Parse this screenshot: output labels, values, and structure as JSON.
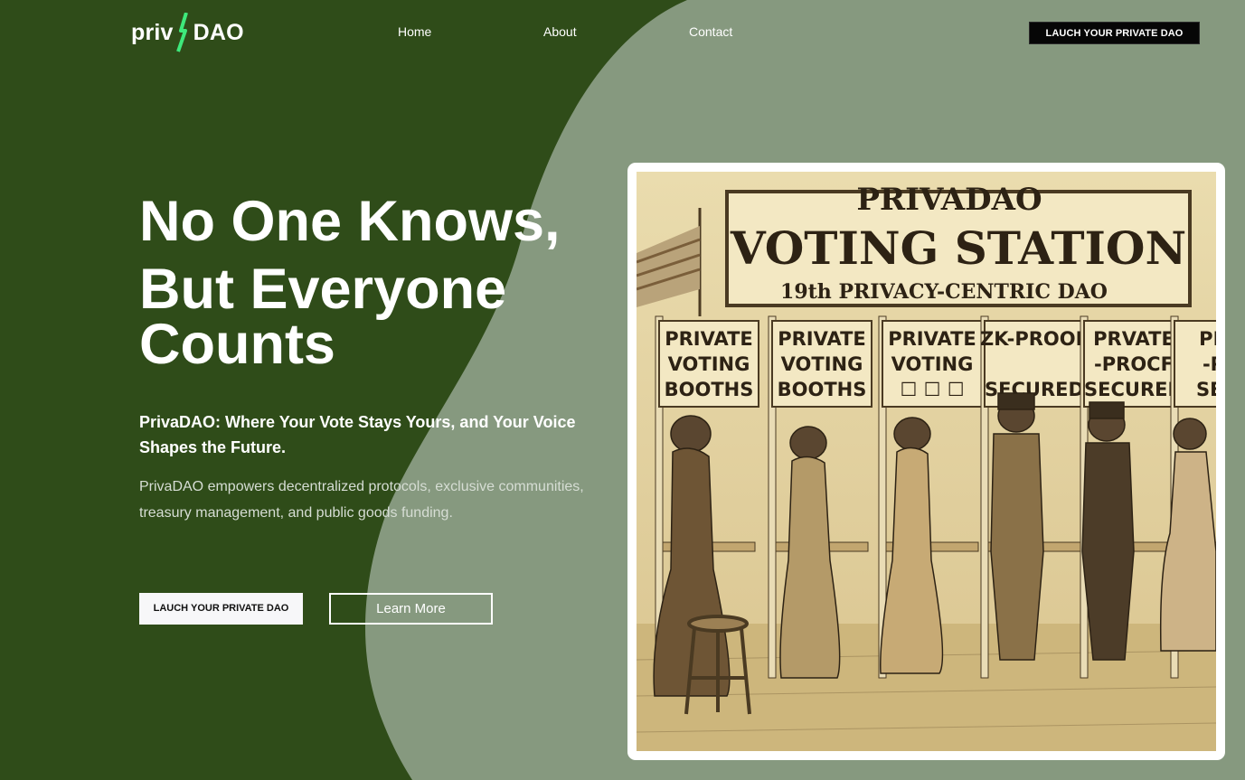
{
  "logo": {
    "left": "priv",
    "right": "DAO"
  },
  "nav": {
    "links": [
      "Home",
      "About",
      "Contact"
    ],
    "cta_label": "LAUCH YOUR PRIVATE DAO"
  },
  "hero": {
    "title_lines": [
      "No One Knows,",
      "But Everyone",
      "Counts"
    ],
    "subtitle": "PrivaDAO: Where Your Vote Stays Yours, and Your Voice Shapes the Future.",
    "description": "PrivaDAO empowers decentralized protocols, exclusive communities, treasury management, and public goods funding.",
    "primary_button_label": "LAUCH YOUR PRIVATE DAO",
    "secondary_button_label": "Learn More"
  },
  "illustration": {
    "sign_title": "PRIVADAO",
    "sign_main": "VOTING STATION",
    "sign_sub": "19th PRIVACY-CENTRIC DAO",
    "booth_signs": [
      [
        "PRIVATE",
        "VOTING",
        "BOOTHS"
      ],
      [
        "PRIVATE",
        "VOTING",
        "BOOTHS"
      ],
      [
        "PRIVATE",
        "VOTING",
        "☐ ☐ ☐"
      ],
      [
        "ZK-PROOF",
        "",
        "SECURED"
      ],
      [
        "PRVATE",
        "-PROCF",
        "SECURED"
      ],
      [
        "PRIV",
        "-PRI",
        "SECU"
      ]
    ]
  },
  "colors": {
    "dark_green": "#2f4c19",
    "sage": "#86997f",
    "accent_green": "#3ee87b",
    "sepia_bg": "#e6d6a6"
  }
}
